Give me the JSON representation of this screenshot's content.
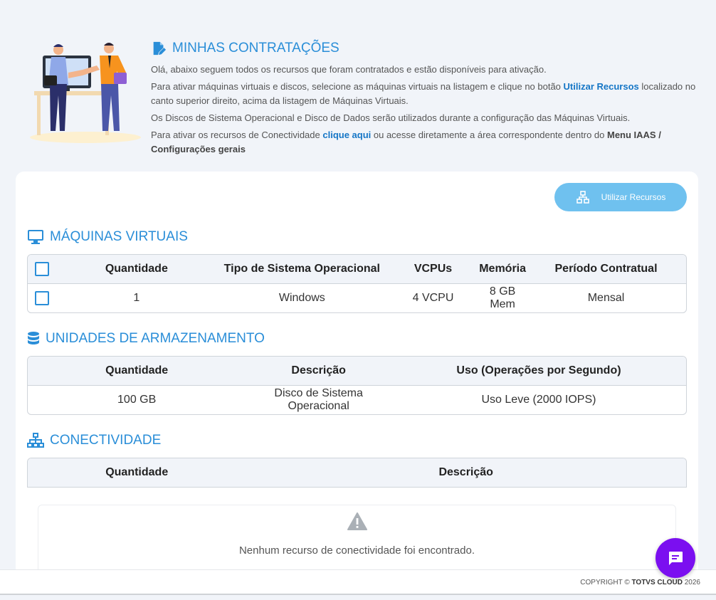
{
  "intro": {
    "title": "MINHAS CONTRATAÇÕES",
    "p1": "Olá, abaixo seguem todos os recursos que foram contratados e estão disponíveis para ativação.",
    "p2_before": "Para ativar máquinas virtuais e discos, selecione as máquinas virtuais na listagem e clique no botão ",
    "p2_link": "Utilizar Recursos",
    "p2_after": " localizado no canto superior direito, acima da listagem de Máquinas Virtuais.",
    "p3": "Os Discos de Sistema Operacional e Disco de Dados serão utilizados durante a configuração das Máquinas Virtuais.",
    "p4_before": "Para ativar os recursos de Conectividade ",
    "p4_link": "clique aqui",
    "p4_middle": " ou acesse diretamente a área correspondente dentro do ",
    "p4_bold": "Menu IAAS / Configurações gerais"
  },
  "toolbar": {
    "use_resources_label": "Utilizar Recursos"
  },
  "vms": {
    "title": "MÁQUINAS VIRTUAIS",
    "headers": [
      "Quantidade",
      "Tipo de Sistema Operacional",
      "VCPUs",
      "Memória",
      "Período Contratual"
    ],
    "rows": [
      {
        "quantidade": "1",
        "tipo": "Windows",
        "vcpus": "4 VCPU",
        "memoria": "8 GB Mem",
        "periodo": "Mensal"
      }
    ]
  },
  "storage": {
    "title": "UNIDADES DE ARMAZENAMENTO",
    "headers": [
      "Quantidade",
      "Descrição",
      "Uso (Operações por Segundo)"
    ],
    "rows": [
      {
        "quantidade": "100 GB",
        "descricao": "Disco de Sistema Operacional",
        "uso": "Uso Leve (2000 IOPS)"
      }
    ]
  },
  "connectivity": {
    "title": "CONECTIVIDADE",
    "headers": [
      "Quantidade",
      "Descrição"
    ],
    "empty_message": "Nenhum recurso de conectividade foi encontrado."
  },
  "footer": {
    "prefix": "COPYRIGHT © ",
    "brand": "TOTVS CLOUD",
    "year": " 2026"
  },
  "colors": {
    "accent": "#2a8ed8",
    "button": "#6fc1ef",
    "chat": "#7b0ff0",
    "background": "#f1f4f9"
  },
  "icons": {
    "intro": "edit-document-icon",
    "vms": "monitor-icon",
    "storage": "database-icon",
    "connectivity": "network-icon",
    "empty": "warning-icon",
    "chat": "chat-bubble-icon"
  }
}
